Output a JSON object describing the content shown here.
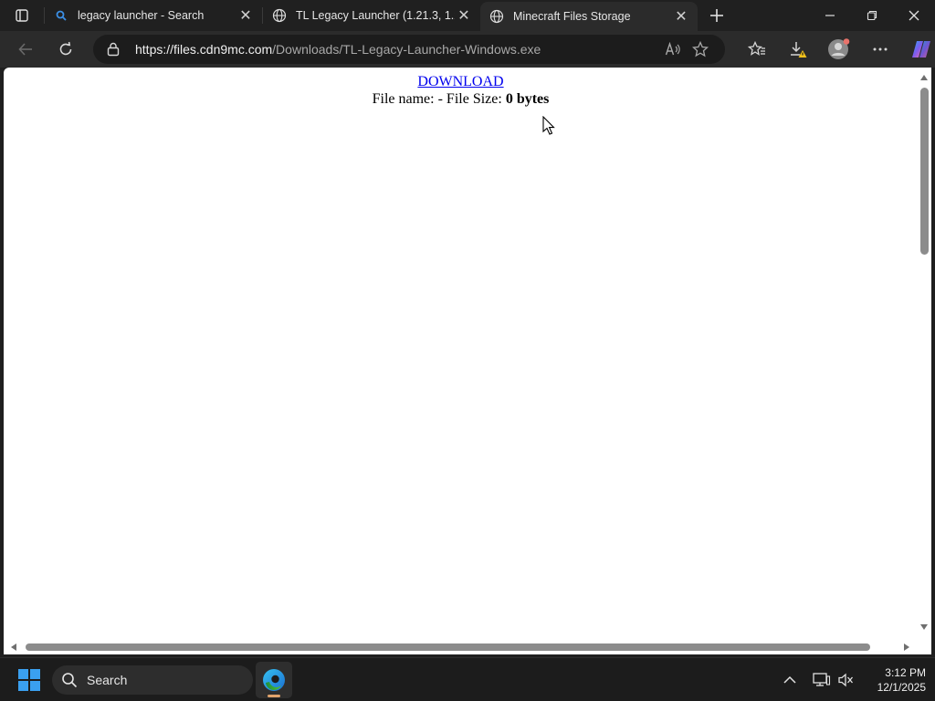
{
  "tabs": [
    {
      "title": "legacy launcher - Search",
      "favicon": "search-icon",
      "active": false
    },
    {
      "title": "TL Legacy Launcher (1.21.3, 1.20.1",
      "favicon": "globe-icon",
      "active": false
    },
    {
      "title": "Minecraft Files Storage",
      "favicon": "globe-icon",
      "active": true
    }
  ],
  "address_bar": {
    "host": "https://files.cdn9mc.com",
    "path": "/Downloads/TL-Legacy-Launcher-Windows.exe"
  },
  "page": {
    "download_link": "DOWNLOAD",
    "file_info_prefix": "File name: - File Size: ",
    "file_size": "0 bytes"
  },
  "taskbar": {
    "search_label": "Search",
    "time": "3:12 PM",
    "date": "12/1/2025"
  },
  "colors": {
    "link": "#0000ee",
    "accent_indicator": "#e0a36c",
    "windows_logo": "#3aa0f0"
  }
}
